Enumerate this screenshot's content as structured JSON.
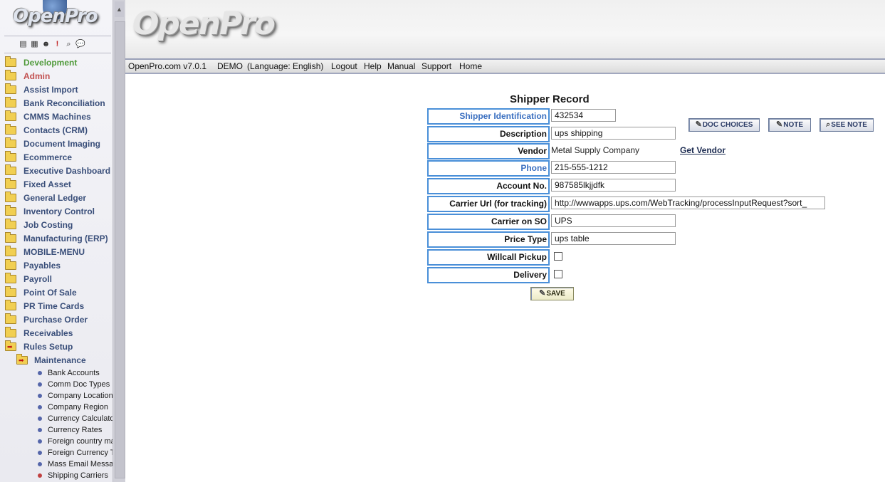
{
  "sidebar": {
    "logo": "OpenPro",
    "tools": [
      "books-icon",
      "calculator-icon",
      "users-icon",
      "exclamation-icon",
      "search-icon",
      "chat-icon"
    ],
    "menu": [
      {
        "label": "Development",
        "style": "dev"
      },
      {
        "label": "Admin",
        "style": "admin"
      },
      {
        "label": "Assist Import"
      },
      {
        "label": "Bank Reconciliation"
      },
      {
        "label": "CMMS Machines"
      },
      {
        "label": "Contacts (CRM)"
      },
      {
        "label": "Document Imaging"
      },
      {
        "label": "Ecommerce"
      },
      {
        "label": "Executive Dashboard"
      },
      {
        "label": "Fixed Asset"
      },
      {
        "label": "General Ledger"
      },
      {
        "label": "Inventory Control"
      },
      {
        "label": "Job Costing"
      },
      {
        "label": "Manufacturing (ERP)"
      },
      {
        "label": "MOBILE-MENU"
      },
      {
        "label": "Payables"
      },
      {
        "label": "Payroll"
      },
      {
        "label": "Point Of Sale"
      },
      {
        "label": "PR Time Cards"
      },
      {
        "label": "Purchase Order"
      },
      {
        "label": "Receivables"
      },
      {
        "label": "Rules Setup",
        "open": true
      }
    ],
    "submenu": {
      "label": "Maintenance"
    },
    "leaves": [
      {
        "label": "Bank Accounts"
      },
      {
        "label": "Comm Doc Types"
      },
      {
        "label": "Company Locations"
      },
      {
        "label": "Company Region"
      },
      {
        "label": "Currency Calculator"
      },
      {
        "label": "Currency Rates"
      },
      {
        "label": "Foreign country ma"
      },
      {
        "label": "Foreign Currency T"
      },
      {
        "label": "Mass Email Messag"
      },
      {
        "label": "Shipping Carriers",
        "active": true
      }
    ]
  },
  "header": {
    "logo": "OpenPro"
  },
  "topnav": {
    "version": "OpenPro.com v7.0.1",
    "demo": "DEMO",
    "language": "(Language: English)",
    "logout": "Logout",
    "help": "Help",
    "manual": "Manual",
    "support": "Support",
    "home": "Home"
  },
  "page": {
    "title": "Shipper Record"
  },
  "form": {
    "shipper_id_label": "Shipper Identification",
    "shipper_id_value": "432534",
    "description_label": "Description",
    "description_value": "ups shipping",
    "vendor_label": "Vendor",
    "vendor_value": "Metal Supply Company",
    "get_vendor": "Get Vendor",
    "phone_label": "Phone",
    "phone_value": "215-555-1212",
    "account_label": "Account No.",
    "account_value": "987585lkjjdfk",
    "carrier_url_label": "Carrier Url (for tracking)",
    "carrier_url_value": "http://wwwapps.ups.com/WebTracking/processInputRequest?sort_",
    "carrier_so_label": "Carrier on SO",
    "carrier_so_value": "UPS",
    "price_type_label": "Price Type",
    "price_type_value": "ups table",
    "willcall_label": "Willcall Pickup",
    "willcall_checked": false,
    "delivery_label": "Delivery",
    "delivery_checked": false
  },
  "buttons": {
    "doc_choices": "DOC CHOICES",
    "note": "NOTE",
    "see_note": "SEE NOTE",
    "save": "SAVE"
  },
  "colors": {
    "label_border": "#4a8fd8",
    "required_label": "#3a6fc0",
    "menu_text": "#3a4f7a",
    "development": "#4f9a3a",
    "admin": "#c25050"
  }
}
